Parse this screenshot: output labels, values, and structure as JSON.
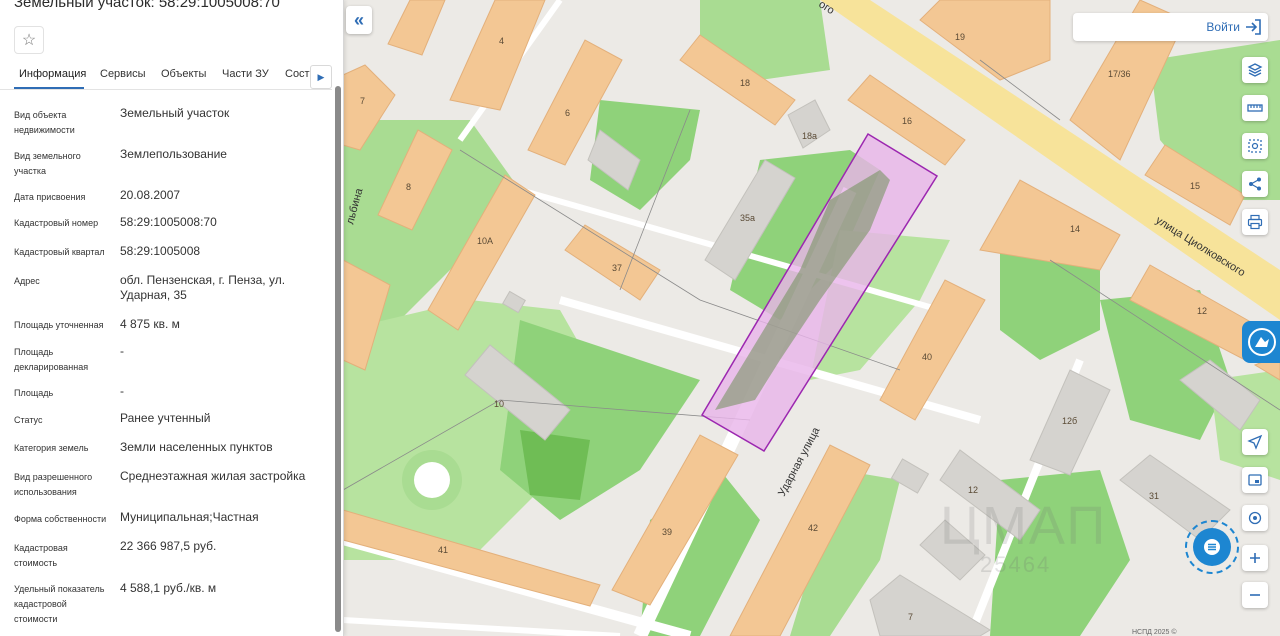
{
  "panel": {
    "title": "Земельный участок: 58:29:1005008:70",
    "tabs": [
      "Информация",
      "Сервисы",
      "Объекты",
      "Части ЗУ",
      "Соста"
    ],
    "properties": [
      {
        "label": "Вид объекта недвижимости",
        "value": "Земельный участок"
      },
      {
        "label": "Вид земельного участка",
        "value": "Землепользование"
      },
      {
        "label": "Дата присвоения",
        "value": "20.08.2007"
      },
      {
        "label": "Кадастровый номер",
        "value": "58:29:1005008:70"
      },
      {
        "label": "Кадастровый квартал",
        "value": "58:29:1005008"
      },
      {
        "label": "Адрес",
        "value": "обл. Пензенская, г. Пенза, ул. Ударная, 35"
      },
      {
        "label": "Площадь уточненная",
        "value": "4 875 кв. м"
      },
      {
        "label": "Площадь декларированная",
        "value": "-"
      },
      {
        "label": "Площадь",
        "value": "-"
      },
      {
        "label": "Статус",
        "value": "Ранее учтенный"
      },
      {
        "label": "Категория земель",
        "value": "Земли населенных пунктов"
      },
      {
        "label": "Вид разрешенного использования",
        "value": "Среднеэтажная жилая застройка"
      },
      {
        "label": "Форма собственности",
        "value": "Муниципальная;Частная"
      },
      {
        "label": "Кадастровая стоимость",
        "value": "22 366 987,5 руб."
      },
      {
        "label": "Удельный показатель кадастровой стоимости",
        "value": "4 588,1 руб./кв. м"
      }
    ]
  },
  "header": {
    "login_label": "Войти"
  },
  "map": {
    "streets": [
      "улица Циолковского",
      "Ударная улица",
      "ого",
      "льбина"
    ],
    "buildings": [
      "4",
      "6",
      "7",
      "8",
      "10А",
      "18",
      "18а",
      "16",
      "19",
      "17/36",
      "15",
      "14",
      "12",
      "35а",
      "37",
      "10",
      "39",
      "40",
      "41",
      "42",
      "12б",
      "12",
      "31",
      "7"
    ],
    "watermark": "ЦМАП",
    "watermark_number": "25464",
    "copyright": "НСПД 2025 ©"
  },
  "colors": {
    "accent": "#2f6db5",
    "parcel_fill": "#e8b4ea",
    "parcel_stroke": "#9c27b0",
    "building": "#f3c794",
    "green": "#8fd27a"
  },
  "icons": [
    "star-icon",
    "collapse-icon",
    "login-icon",
    "layers-icon",
    "ruler-icon",
    "select-area-icon",
    "share-icon",
    "print-icon",
    "locate-icon",
    "legend-icon",
    "gps-icon",
    "zoom-in-icon",
    "zoom-out-icon",
    "chat-icon",
    "logo-badge-icon"
  ]
}
